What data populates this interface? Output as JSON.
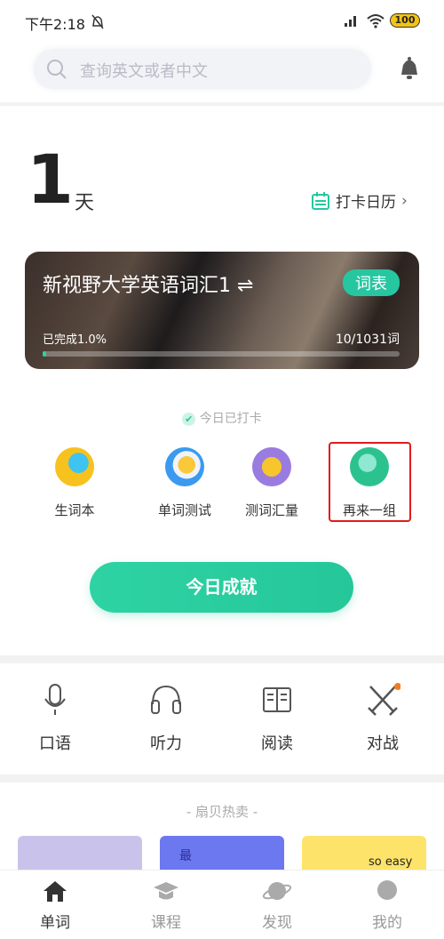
{
  "status_bar": {
    "time": "下午2:18",
    "battery": "100"
  },
  "search": {
    "placeholder": "查询英文或者中文"
  },
  "checkin": {
    "days": "1",
    "unit": "天",
    "calendar_label": "打卡日历"
  },
  "book": {
    "title": "新视野大学英语词汇1",
    "badge": "词表",
    "progress_label": "已完成1.0%",
    "progress_percent": 1.0,
    "count": "10/1031词"
  },
  "checked_today": "今日已打卡",
  "tools": [
    {
      "label": "生词本",
      "icon": "notebook-pen-icon"
    },
    {
      "label": "单词测试",
      "icon": "word-test-icon"
    },
    {
      "label": "测词汇量",
      "icon": "vocab-chart-icon"
    },
    {
      "label": "再来一组",
      "icon": "another-group-icon"
    }
  ],
  "achievement_button": "今日成就",
  "skills": [
    {
      "label": "口语",
      "icon": "microphone-icon"
    },
    {
      "label": "听力",
      "icon": "headphones-icon"
    },
    {
      "label": "阅读",
      "icon": "book-icon"
    },
    {
      "label": "对战",
      "icon": "crossed-swords-icon"
    }
  ],
  "hot_section": "- 扇贝热卖 -",
  "products": [
    {
      "label": ""
    },
    {
      "label": "最"
    },
    {
      "label": "so easy"
    }
  ],
  "nav": [
    {
      "label": "单词",
      "active": true
    },
    {
      "label": "课程"
    },
    {
      "label": "发现"
    },
    {
      "label": "我的"
    }
  ],
  "colors": {
    "accent": "#26c6a0",
    "highlight": "#e01b1b"
  }
}
